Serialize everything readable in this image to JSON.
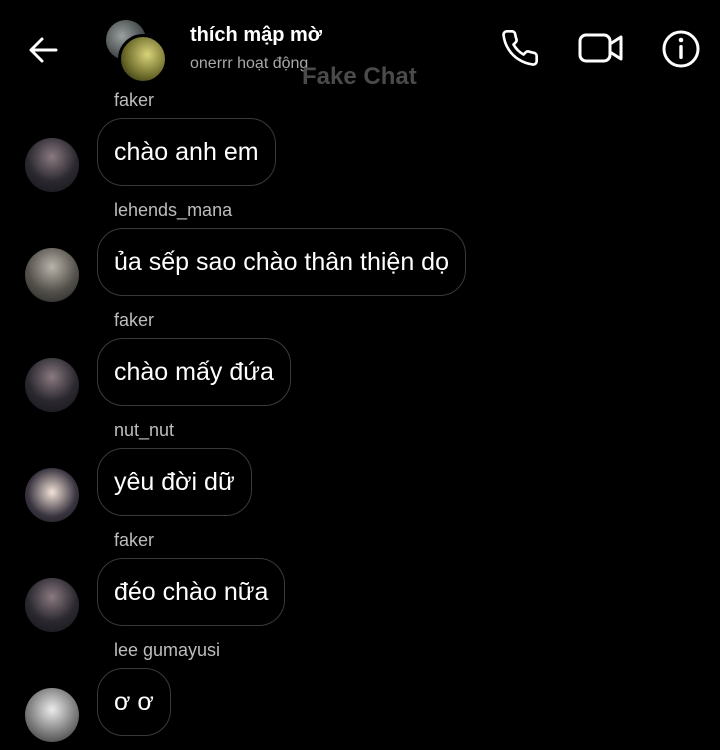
{
  "header": {
    "title": "thích mập mờ",
    "status": "onerrr hoạt động",
    "watermark": "Fake Chat",
    "icons": [
      "back-arrow-icon",
      "phone-icon",
      "video-camera-icon",
      "info-icon"
    ]
  },
  "messages": [
    {
      "sender": "faker",
      "text": "chào anh em"
    },
    {
      "sender": "lehends_mana",
      "text": "ủa sếp sao chào thân thiện dọ"
    },
    {
      "sender": "faker",
      "text": "chào mấy đứa"
    },
    {
      "sender": "nut_nut",
      "text": "yêu đời dữ"
    },
    {
      "sender": "faker",
      "text": "đéo chào nữa"
    },
    {
      "sender": "lee gumayusi",
      "text": "ơ ơ"
    }
  ],
  "colors": {
    "background": "#000000",
    "bubble_border": "#3a3a3a",
    "sender_text": "#bdbdbd"
  }
}
